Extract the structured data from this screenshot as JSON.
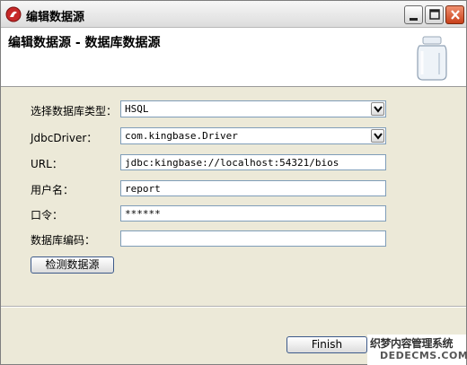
{
  "window": {
    "title": "编辑数据源"
  },
  "header": {
    "title": "编辑数据源 - 数据库数据源"
  },
  "form": {
    "db_type": {
      "label": "选择数据库类型：",
      "value": "HSQL"
    },
    "jdbc_driver": {
      "label": "JdbcDriver：",
      "value": "com.kingbase.Driver"
    },
    "url": {
      "label": "URL：",
      "value": "jdbc:kingbase://localhost:54321/bios"
    },
    "username": {
      "label": "用户名：",
      "value": "report"
    },
    "password": {
      "label": "口令：",
      "value": "******"
    },
    "db_encoding": {
      "label": "数据库编码：",
      "value": ""
    },
    "test_button": "检测数据源"
  },
  "footer": {
    "finish_button": "Finish"
  },
  "watermark": {
    "line1": "织梦内容管理系统",
    "line2": "DEDECMS.COM"
  },
  "icons": {
    "app": "app-logo-icon",
    "minimize": "minimize-icon",
    "maximize": "maximize-icon",
    "close": "close-icon",
    "jar": "jar-icon",
    "dropdown": "chevron-down-icon"
  },
  "colors": {
    "close_button": "#d9542b",
    "dialog_background": "#ece9d8",
    "field_border": "#7f9db9"
  }
}
